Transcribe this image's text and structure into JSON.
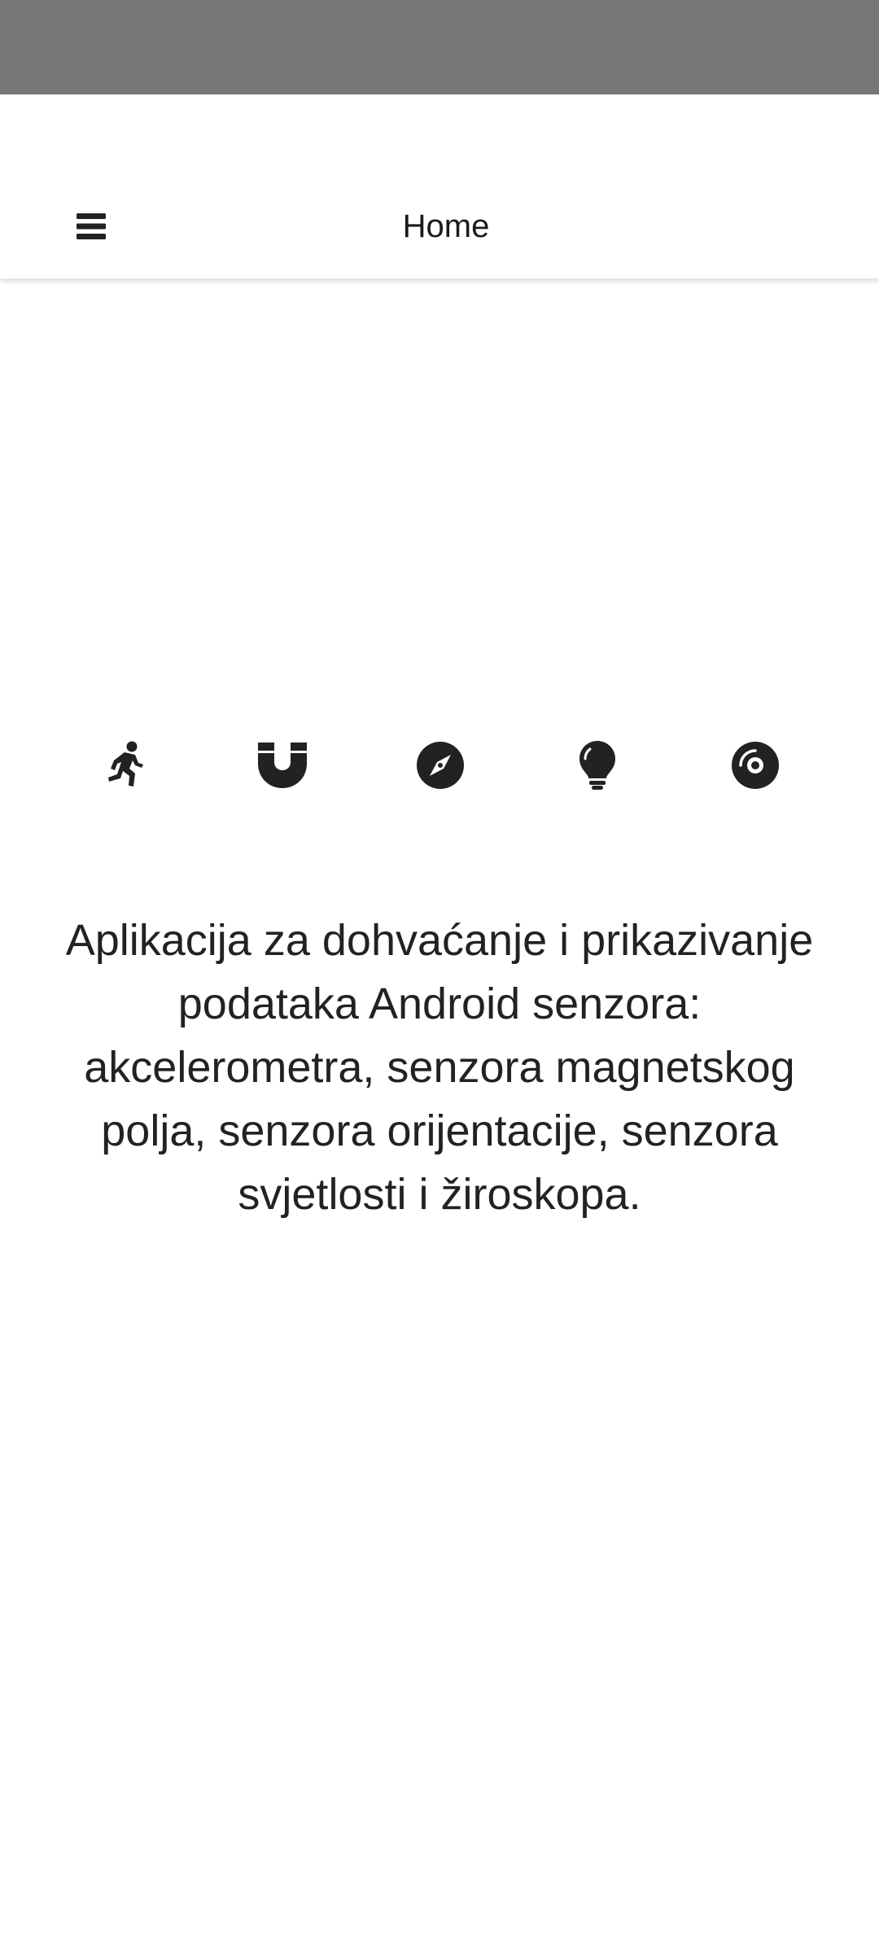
{
  "app_bar": {
    "title": "Home",
    "menu_icon": "hamburger-menu-icon"
  },
  "sensors": [
    {
      "icon": "running-person-icon"
    },
    {
      "icon": "magnet-icon"
    },
    {
      "icon": "compass-icon"
    },
    {
      "icon": "lightbulb-icon"
    },
    {
      "icon": "gyroscope-disc-icon"
    }
  ],
  "description": "Aplikacija za dohvaćanje i prikazivanje podataka Android senzora: akcelerometra, senzora magnetskog polja, senzora orijentacije, senzora svjetlosti i žiroskopa.",
  "colors": {
    "status_bar": "#777777",
    "background": "#ffffff",
    "text": "#222222",
    "icon": "#222222"
  }
}
